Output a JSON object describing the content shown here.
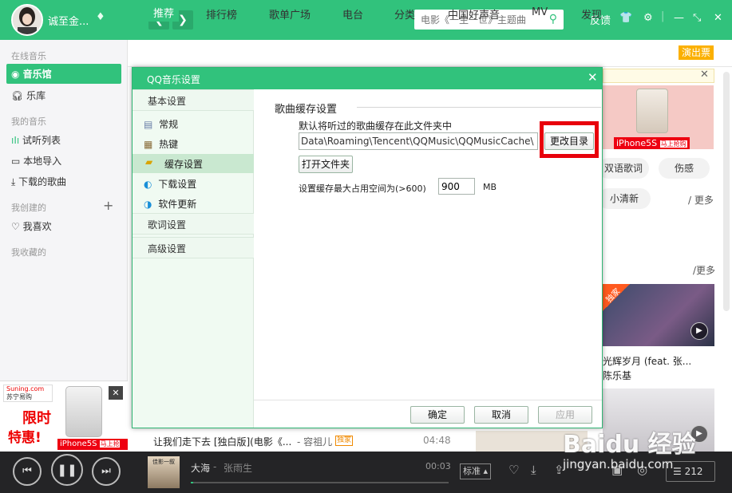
{
  "header": {
    "username": "诚至金...",
    "search_placeholder": "电影《一生一世》主题曲",
    "feedback": "反馈"
  },
  "tabs": [
    "推荐",
    "排行榜",
    "歌单广场",
    "电台",
    "分类",
    "中国好声音",
    "MV",
    "发现"
  ],
  "show_ticket": "演出票",
  "sidebar": {
    "online_music": "在线音乐",
    "music_hall": "音乐馆",
    "library": "乐库",
    "my_music": "我的音乐",
    "trial_list": "试听列表",
    "local_import": "本地导入",
    "downloaded": "下载的歌曲",
    "my_created": "我创建的",
    "favorites": "我喜欢",
    "my_collected": "我收藏的"
  },
  "ad": {
    "brand": "Suning.com",
    "brand_cn": "苏宁易购",
    "slogan_1": "限时",
    "slogan_2": "特惠!",
    "product": "iPhone5S",
    "buy": "马上抢购"
  },
  "right_panel": {
    "product": "iPhone5S",
    "buy": "马上抢购",
    "tag_1": "双语歌词",
    "tag_2": "伤感",
    "tag_3": "小清新",
    "more_1": "/ 更多",
    "more_2": "/更多",
    "exclusive": "独家",
    "song_title": "光辉岁月 (feat. 张...",
    "song_artist": "陈乐基"
  },
  "dialog": {
    "title": "QQ音乐设置",
    "nav": {
      "basic": "基本设置",
      "general": "常规",
      "hotkeys": "热键",
      "cache": "缓存设置",
      "download": "下载设置",
      "update": "软件更新",
      "lyrics": "歌词设置",
      "advanced": "高级设置"
    },
    "section_title": "歌曲缓存设置",
    "folder_desc": "默认将听过的歌曲缓存在此文件夹中",
    "cache_path": "Data\\Roaming\\Tencent\\QQMusic\\QQMusicCache\\",
    "change_dir": "更改目录",
    "open_folder": "打开文件夹",
    "max_space_label": "设置缓存最大占用空间为(>600)",
    "max_space_value": "900",
    "unit": "MB",
    "ok": "确定",
    "cancel": "取消",
    "apply": "应用"
  },
  "list_row": {
    "title": "让我们走下去 [独白版](电影《...",
    "artist": "- 容祖儿",
    "badge": "独家",
    "duration": "04:48"
  },
  "player": {
    "song": "大海",
    "artist": "张雨生",
    "album_text": "佳影一叙",
    "time": "00:03",
    "quality": "标准",
    "count": "212",
    "progress": 0.01
  },
  "watermark": {
    "brand": "Baidu 经验",
    "url": "jingyan.baidu.com"
  },
  "colors": {
    "brand_green": "#31c27c",
    "highlight_red": "#e8000b",
    "badge_orange": "#fbb000",
    "player_bg": "#242426"
  }
}
